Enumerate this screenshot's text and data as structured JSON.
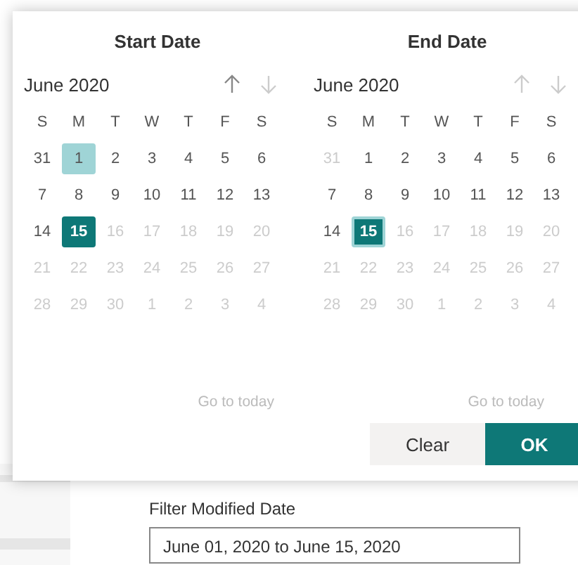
{
  "calendars": [
    {
      "title": "Start Date",
      "month": "June 2020",
      "nav": [
        {
          "kind": "up",
          "disabled": false
        },
        {
          "kind": "down",
          "disabled": true
        }
      ],
      "weekdays": [
        "S",
        "M",
        "T",
        "W",
        "T",
        "F",
        "S"
      ],
      "days": [
        {
          "day": "31",
          "dim": false,
          "selected": false,
          "highlight": false
        },
        {
          "day": "1",
          "dim": false,
          "selected": false,
          "highlight": true
        },
        {
          "day": "2",
          "dim": false,
          "selected": false,
          "highlight": false
        },
        {
          "day": "3",
          "dim": false,
          "selected": false,
          "highlight": false
        },
        {
          "day": "4",
          "dim": false,
          "selected": false,
          "highlight": false
        },
        {
          "day": "5",
          "dim": false,
          "selected": false,
          "highlight": false
        },
        {
          "day": "6",
          "dim": false,
          "selected": false,
          "highlight": false
        },
        {
          "day": "7",
          "dim": false,
          "selected": false,
          "highlight": false
        },
        {
          "day": "8",
          "dim": false,
          "selected": false,
          "highlight": false
        },
        {
          "day": "9",
          "dim": false,
          "selected": false,
          "highlight": false
        },
        {
          "day": "10",
          "dim": false,
          "selected": false,
          "highlight": false
        },
        {
          "day": "11",
          "dim": false,
          "selected": false,
          "highlight": false
        },
        {
          "day": "12",
          "dim": false,
          "selected": false,
          "highlight": false
        },
        {
          "day": "13",
          "dim": false,
          "selected": false,
          "highlight": false
        },
        {
          "day": "14",
          "dim": false,
          "selected": false,
          "highlight": false
        },
        {
          "day": "15",
          "dim": false,
          "selected": true,
          "highlight": false
        },
        {
          "day": "16",
          "dim": true,
          "selected": false,
          "highlight": false
        },
        {
          "day": "17",
          "dim": true,
          "selected": false,
          "highlight": false
        },
        {
          "day": "18",
          "dim": true,
          "selected": false,
          "highlight": false
        },
        {
          "day": "19",
          "dim": true,
          "selected": false,
          "highlight": false
        },
        {
          "day": "20",
          "dim": true,
          "selected": false,
          "highlight": false
        },
        {
          "day": "21",
          "dim": true,
          "selected": false,
          "highlight": false
        },
        {
          "day": "22",
          "dim": true,
          "selected": false,
          "highlight": false
        },
        {
          "day": "23",
          "dim": true,
          "selected": false,
          "highlight": false
        },
        {
          "day": "24",
          "dim": true,
          "selected": false,
          "highlight": false
        },
        {
          "day": "25",
          "dim": true,
          "selected": false,
          "highlight": false
        },
        {
          "day": "26",
          "dim": true,
          "selected": false,
          "highlight": false
        },
        {
          "day": "27",
          "dim": true,
          "selected": false,
          "highlight": false
        },
        {
          "day": "28",
          "dim": true,
          "selected": false,
          "highlight": false
        },
        {
          "day": "29",
          "dim": true,
          "selected": false,
          "highlight": false
        },
        {
          "day": "30",
          "dim": true,
          "selected": false,
          "highlight": false
        },
        {
          "day": "1",
          "dim": true,
          "selected": false,
          "highlight": false
        },
        {
          "day": "2",
          "dim": true,
          "selected": false,
          "highlight": false
        },
        {
          "day": "3",
          "dim": true,
          "selected": false,
          "highlight": false
        },
        {
          "day": "4",
          "dim": true,
          "selected": false,
          "highlight": false
        }
      ],
      "today_link": "Go to today"
    },
    {
      "title": "End Date",
      "month": "June 2020",
      "nav": [
        {
          "kind": "up",
          "disabled": true
        },
        {
          "kind": "down",
          "disabled": true
        }
      ],
      "weekdays": [
        "S",
        "M",
        "T",
        "W",
        "T",
        "F",
        "S"
      ],
      "days": [
        {
          "day": "31",
          "dim": true,
          "selected": false,
          "highlight": false
        },
        {
          "day": "1",
          "dim": false,
          "selected": false,
          "highlight": false
        },
        {
          "day": "2",
          "dim": false,
          "selected": false,
          "highlight": false
        },
        {
          "day": "3",
          "dim": false,
          "selected": false,
          "highlight": false
        },
        {
          "day": "4",
          "dim": false,
          "selected": false,
          "highlight": false
        },
        {
          "day": "5",
          "dim": false,
          "selected": false,
          "highlight": false
        },
        {
          "day": "6",
          "dim": false,
          "selected": false,
          "highlight": false
        },
        {
          "day": "7",
          "dim": false,
          "selected": false,
          "highlight": false
        },
        {
          "day": "8",
          "dim": false,
          "selected": false,
          "highlight": false
        },
        {
          "day": "9",
          "dim": false,
          "selected": false,
          "highlight": false
        },
        {
          "day": "10",
          "dim": false,
          "selected": false,
          "highlight": false
        },
        {
          "day": "11",
          "dim": false,
          "selected": false,
          "highlight": false
        },
        {
          "day": "12",
          "dim": false,
          "selected": false,
          "highlight": false
        },
        {
          "day": "13",
          "dim": false,
          "selected": false,
          "highlight": false
        },
        {
          "day": "14",
          "dim": false,
          "selected": false,
          "highlight": false
        },
        {
          "day": "15",
          "dim": false,
          "selected": true,
          "highlight": true
        },
        {
          "day": "16",
          "dim": true,
          "selected": false,
          "highlight": false
        },
        {
          "day": "17",
          "dim": true,
          "selected": false,
          "highlight": false
        },
        {
          "day": "18",
          "dim": true,
          "selected": false,
          "highlight": false
        },
        {
          "day": "19",
          "dim": true,
          "selected": false,
          "highlight": false
        },
        {
          "day": "20",
          "dim": true,
          "selected": false,
          "highlight": false
        },
        {
          "day": "21",
          "dim": true,
          "selected": false,
          "highlight": false
        },
        {
          "day": "22",
          "dim": true,
          "selected": false,
          "highlight": false
        },
        {
          "day": "23",
          "dim": true,
          "selected": false,
          "highlight": false
        },
        {
          "day": "24",
          "dim": true,
          "selected": false,
          "highlight": false
        },
        {
          "day": "25",
          "dim": true,
          "selected": false,
          "highlight": false
        },
        {
          "day": "26",
          "dim": true,
          "selected": false,
          "highlight": false
        },
        {
          "day": "27",
          "dim": true,
          "selected": false,
          "highlight": false
        },
        {
          "day": "28",
          "dim": true,
          "selected": false,
          "highlight": false
        },
        {
          "day": "29",
          "dim": true,
          "selected": false,
          "highlight": false
        },
        {
          "day": "30",
          "dim": true,
          "selected": false,
          "highlight": false
        },
        {
          "day": "1",
          "dim": true,
          "selected": false,
          "highlight": false
        },
        {
          "day": "2",
          "dim": true,
          "selected": false,
          "highlight": false
        },
        {
          "day": "3",
          "dim": true,
          "selected": false,
          "highlight": false
        },
        {
          "day": "4",
          "dim": true,
          "selected": false,
          "highlight": false
        }
      ],
      "today_link": "Go to today"
    }
  ],
  "buttons": [
    {
      "label": "Clear",
      "kind": "secondary"
    },
    {
      "label": "OK",
      "kind": "primary"
    }
  ],
  "filter": {
    "label": "Filter Modified Date",
    "value": "June 01, 2020 to June 15, 2020"
  }
}
